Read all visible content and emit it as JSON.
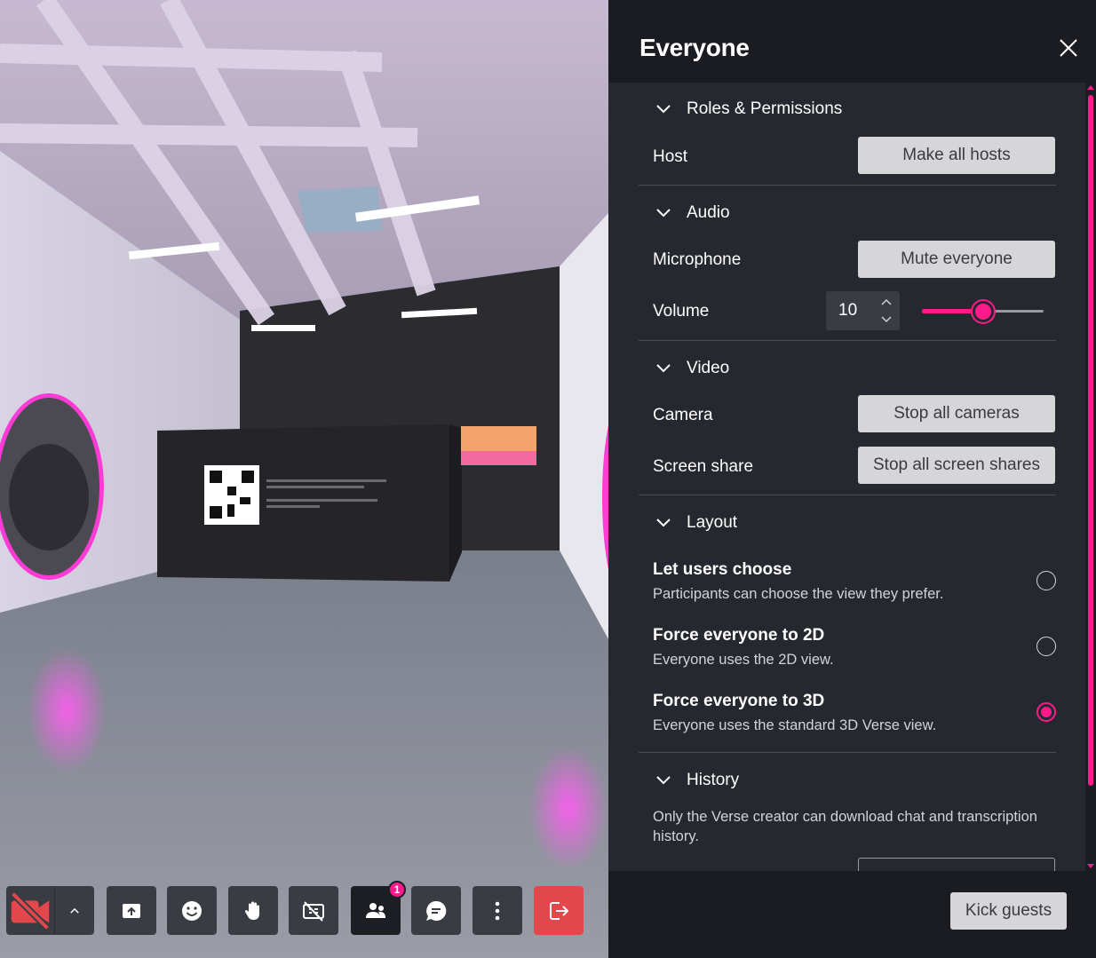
{
  "panel": {
    "title": "Everyone",
    "sections": {
      "roles": {
        "heading": "Roles & Permissions",
        "host_label": "Host",
        "host_button": "Make all hosts"
      },
      "audio": {
        "heading": "Audio",
        "mic_label": "Microphone",
        "mic_button": "Mute everyone",
        "volume_label": "Volume",
        "volume_value": "10",
        "volume_level": 0.5
      },
      "video": {
        "heading": "Video",
        "camera_label": "Camera",
        "camera_button": "Stop all cameras",
        "share_label": "Screen share",
        "share_button": "Stop all screen shares"
      },
      "layout": {
        "heading": "Layout",
        "options": [
          {
            "title": "Let users choose",
            "desc": "Participants can choose the view they prefer.",
            "checked": false
          },
          {
            "title": "Force everyone to 2D",
            "desc": "Everyone uses the 2D view.",
            "checked": false
          },
          {
            "title": "Force everyone to 3D",
            "desc": "Everyone uses the standard 3D Verse view.",
            "checked": true
          }
        ]
      },
      "history": {
        "heading": "History",
        "text": "Only the Verse creator can download chat and transcription history."
      }
    },
    "footer": {
      "kick_button": "Kick guests"
    }
  },
  "toolbar": {
    "participants_badge": "1"
  },
  "colors": {
    "accent": "#ff1a8c",
    "panel_bg": "#1b1c21",
    "section_bg": "#26282f",
    "leave": "#e2474c"
  },
  "icons": [
    "camera-off-icon",
    "chevron-up-icon",
    "share-screen-icon",
    "emoji-icon",
    "raise-hand-icon",
    "captions-off-icon",
    "people-icon",
    "chat-icon",
    "more-icon",
    "leave-icon",
    "close-icon",
    "chevron-down-icon"
  ]
}
